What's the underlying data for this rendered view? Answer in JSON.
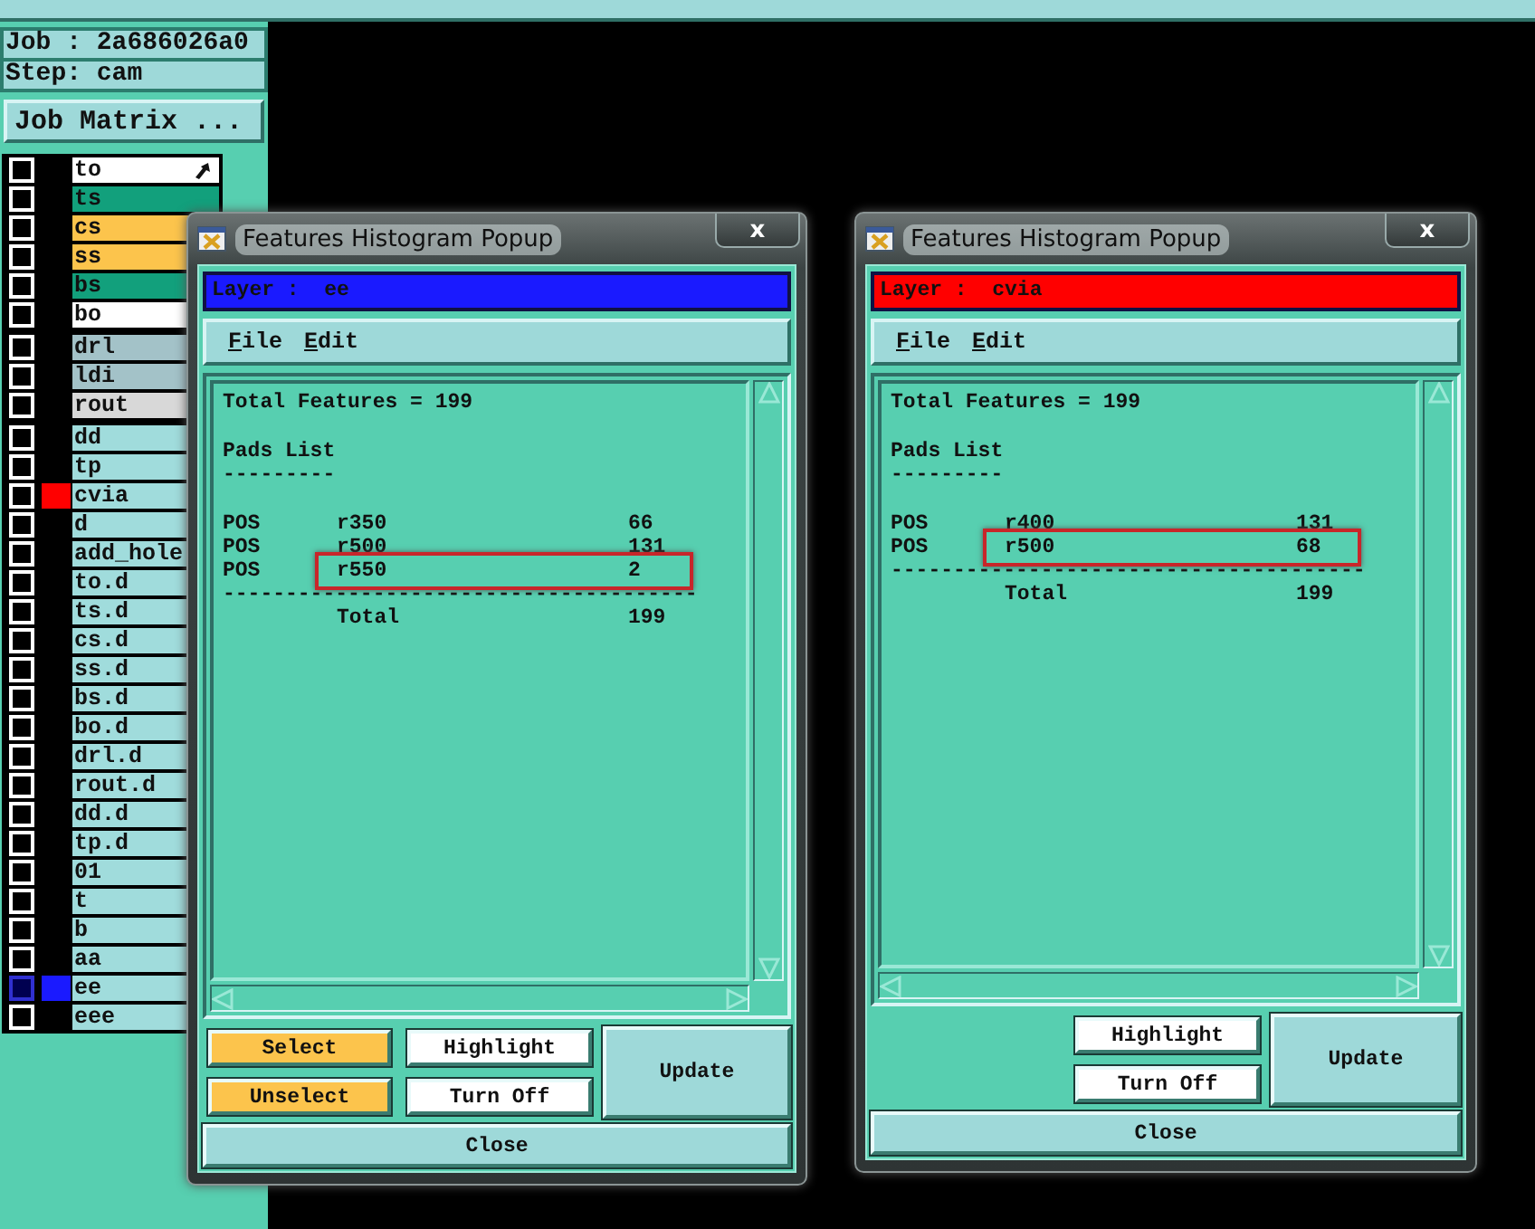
{
  "job_label": "Job : 2a686026a0",
  "step_label": "Step: cam",
  "job_matrix_button": "Job Matrix ...",
  "layer_groups": [
    {
      "layers": [
        {
          "name": "to",
          "color": "#ffffff",
          "checked": false,
          "selected": false,
          "pointer": true
        },
        {
          "name": "ts",
          "color": "#12a07c",
          "checked": false,
          "selected": false
        },
        {
          "name": "cs",
          "color": "#fcc44c",
          "checked": false,
          "selected": false
        },
        {
          "name": "ss",
          "color": "#fcc44c",
          "checked": false,
          "selected": false
        },
        {
          "name": "bs",
          "color": "#12a07c",
          "checked": false,
          "selected": false
        },
        {
          "name": "bo",
          "color": "#ffffff",
          "checked": false,
          "selected": false
        }
      ]
    },
    {
      "layers": [
        {
          "name": "drl",
          "color": "#a3c2c8",
          "checked": false,
          "selected": false
        },
        {
          "name": "ldi",
          "color": "#a3c2c8",
          "checked": false,
          "selected": false
        },
        {
          "name": "rout",
          "color": "#d8d8d8",
          "checked": false,
          "selected": false
        }
      ]
    },
    {
      "layers": [
        {
          "name": "dd",
          "color": "#a0dcdc",
          "checked": false,
          "selected": false
        },
        {
          "name": "tp",
          "color": "#a0dcdc",
          "checked": false,
          "selected": false
        },
        {
          "name": "cvia",
          "color": "#a0dcdc",
          "checked": false,
          "selected": false,
          "marker": {
            "color": "#ff0000"
          }
        },
        {
          "name": "d",
          "color": "#a0dcdc",
          "checked": false,
          "selected": false
        },
        {
          "name": "add_hole",
          "color": "#a0dcdc",
          "checked": false,
          "selected": false
        },
        {
          "name": "to.d",
          "color": "#a0dcdc",
          "checked": false,
          "selected": false
        },
        {
          "name": "ts.d",
          "color": "#a0dcdc",
          "checked": false,
          "selected": false
        },
        {
          "name": "cs.d",
          "color": "#a0dcdc",
          "checked": false,
          "selected": false
        },
        {
          "name": "ss.d",
          "color": "#a0dcdc",
          "checked": false,
          "selected": false
        },
        {
          "name": "bs.d",
          "color": "#a0dcdc",
          "checked": false,
          "selected": false
        },
        {
          "name": "bo.d",
          "color": "#a0dcdc",
          "checked": false,
          "selected": false
        },
        {
          "name": "drl.d",
          "color": "#a0dcdc",
          "checked": false,
          "selected": false
        },
        {
          "name": "rout.d",
          "color": "#a0dcdc",
          "checked": false,
          "selected": false
        },
        {
          "name": "dd.d",
          "color": "#a0dcdc",
          "checked": false,
          "selected": false
        },
        {
          "name": "tp.d",
          "color": "#a0dcdc",
          "checked": false,
          "selected": false
        },
        {
          "name": "01",
          "color": "#a0dcdc",
          "checked": false,
          "selected": false
        },
        {
          "name": "t",
          "color": "#a0dcdc",
          "checked": false,
          "selected": false
        },
        {
          "name": "b",
          "color": "#a0dcdc",
          "checked": false,
          "selected": false
        },
        {
          "name": "aa",
          "color": "#a0dcdc",
          "checked": false,
          "selected": false
        },
        {
          "name": "ee",
          "color": "#a0dcdc",
          "checked": false,
          "selected": true,
          "marker": {
            "color": "#1a1aff"
          }
        },
        {
          "name": "eee",
          "color": "#a0dcdc",
          "checked": false,
          "selected": false
        }
      ]
    }
  ],
  "windows": [
    {
      "title": "Features Histogram Popup",
      "close_glyph": "x",
      "layer_bar": {
        "label": "Layer :  ee",
        "color": "#1a1aff"
      },
      "menu": [
        "File",
        "Edit"
      ],
      "report": {
        "total_line": "Total Features = 199",
        "section_title": "Pads List",
        "section_rule": "---------",
        "rows": [
          {
            "type": "POS",
            "symbol": "r350",
            "count": "66",
            "marked": false
          },
          {
            "type": "POS",
            "symbol": "r500",
            "count": "131",
            "marked": false
          },
          {
            "type": "POS",
            "symbol": "r550",
            "count": "2",
            "marked": true
          }
        ],
        "total_rule": "--------------------------------------",
        "total_label": "Total",
        "total_count": "199"
      },
      "buttons": [
        {
          "label": "Select",
          "kind": "action"
        },
        {
          "label": "Unselect",
          "kind": "action"
        },
        {
          "label": "Highlight",
          "kind": "toggle"
        },
        {
          "label": "Turn Off",
          "kind": "toggle"
        },
        {
          "label": "Update",
          "kind": "update"
        },
        {
          "label": "Close",
          "kind": "close"
        }
      ]
    },
    {
      "title": "Features Histogram Popup",
      "close_glyph": "x",
      "layer_bar": {
        "label": "Layer :  cvia",
        "color": "#ff0000"
      },
      "menu": [
        "File",
        "Edit"
      ],
      "report": {
        "total_line": "Total Features = 199",
        "section_title": "Pads List",
        "section_rule": "---------",
        "rows": [
          {
            "type": "POS",
            "symbol": "r400",
            "count": "131",
            "marked": false
          },
          {
            "type": "POS",
            "symbol": "r500",
            "count": "68",
            "marked": true
          }
        ],
        "total_rule": "--------------------------------------",
        "total_label": "Total",
        "total_count": "199"
      },
      "buttons": [
        {
          "label": "Highlight",
          "kind": "toggle"
        },
        {
          "label": "Turn Off",
          "kind": "toggle"
        },
        {
          "label": "Update",
          "kind": "update"
        },
        {
          "label": "Close",
          "kind": "close"
        }
      ]
    }
  ]
}
